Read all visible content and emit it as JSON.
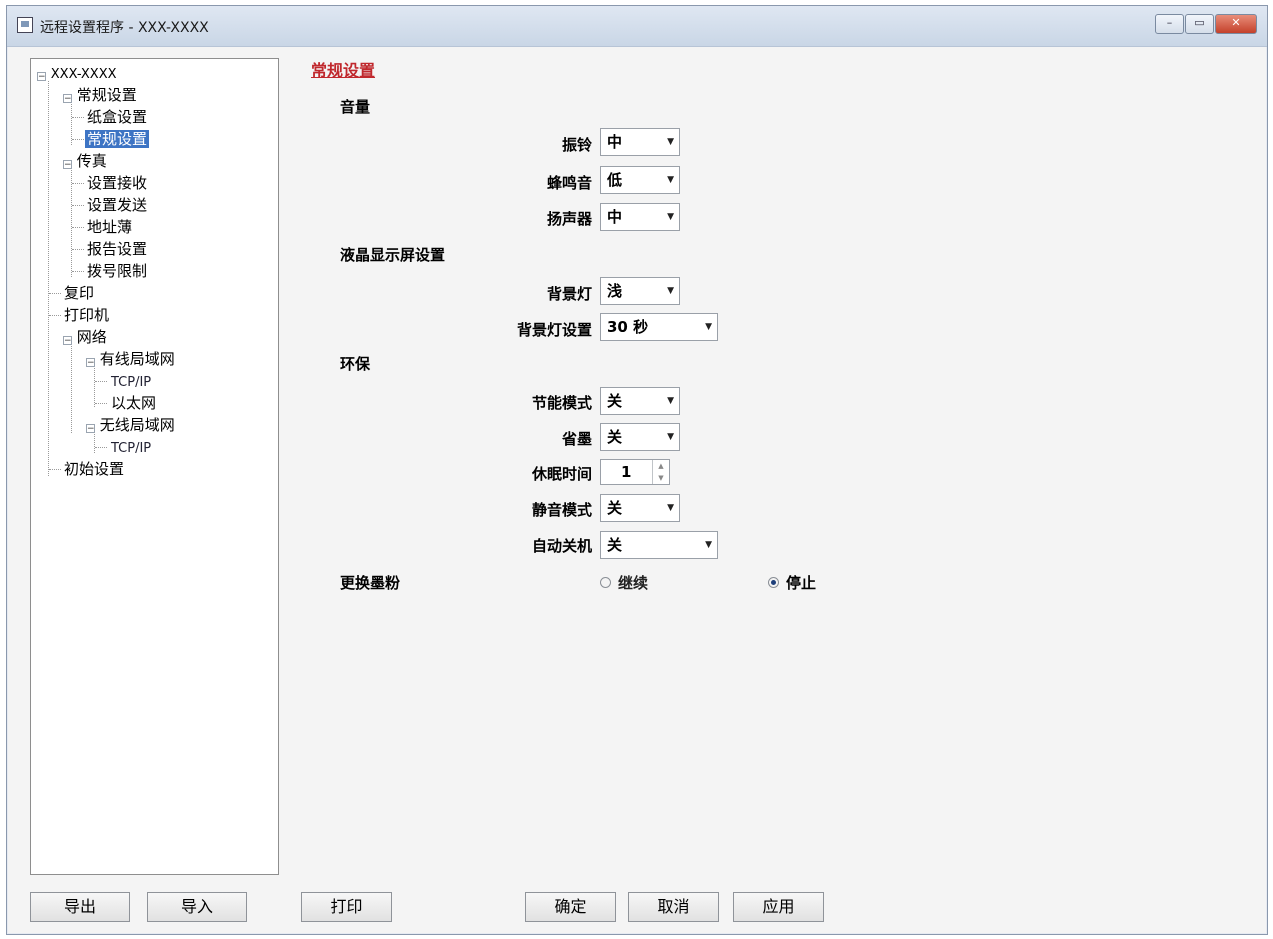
{
  "window": {
    "title": "远程设置程序 - XXX-XXXX",
    "controls": {
      "minimize": "–",
      "maximize": "▭",
      "close": "✕"
    }
  },
  "tree": {
    "root": "XXX-XXXX",
    "general": "常规设置",
    "tray": "纸盒设置",
    "general_selected": "常规设置",
    "fax": "传真",
    "fax_receive": "设置接收",
    "fax_send": "设置发送",
    "address_book": "地址薄",
    "report": "报告设置",
    "dial_restrict": "拨号限制",
    "copy": "复印",
    "printer": "打印机",
    "network": "网络",
    "wired": "有线局域网",
    "wired_tcpip": "TCP/IP",
    "ethernet": "以太网",
    "wireless": "无线局域网",
    "wireless_tcpip": "TCP/IP",
    "initial": "初始设置"
  },
  "main": {
    "title": "常规设置",
    "volume": {
      "label": "音量",
      "ring_label": "振铃",
      "ring_value": "中",
      "beeper_label": "蜂鸣音",
      "beeper_value": "低",
      "speaker_label": "扬声器",
      "speaker_value": "中"
    },
    "lcd": {
      "label": "液晶显示屏设置",
      "backlight_label": "背景灯",
      "backlight_value": "浅",
      "backlight_timer_label": "背景灯设置",
      "backlight_timer_value": "30 秒"
    },
    "eco": {
      "label": "环保",
      "eco_mode_label": "节能模式",
      "eco_mode_value": "关",
      "toner_save_label": "省墨",
      "toner_save_value": "关",
      "sleep_label": "休眠时间",
      "sleep_value": "1",
      "quiet_label": "静音模式",
      "quiet_value": "关",
      "auto_off_label": "自动关机",
      "auto_off_value": "关"
    },
    "toner": {
      "label": "更换墨粉",
      "continue_label": "继续",
      "continue_checked": false,
      "stop_label": "停止",
      "stop_checked": true
    }
  },
  "buttons": {
    "export": "导出",
    "import": "导入",
    "print": "打印",
    "ok": "确定",
    "cancel": "取消",
    "apply": "应用"
  },
  "icons": {
    "dropdown": "▼",
    "spin_up": "▲",
    "spin_down": "▼",
    "collapse": "−"
  }
}
